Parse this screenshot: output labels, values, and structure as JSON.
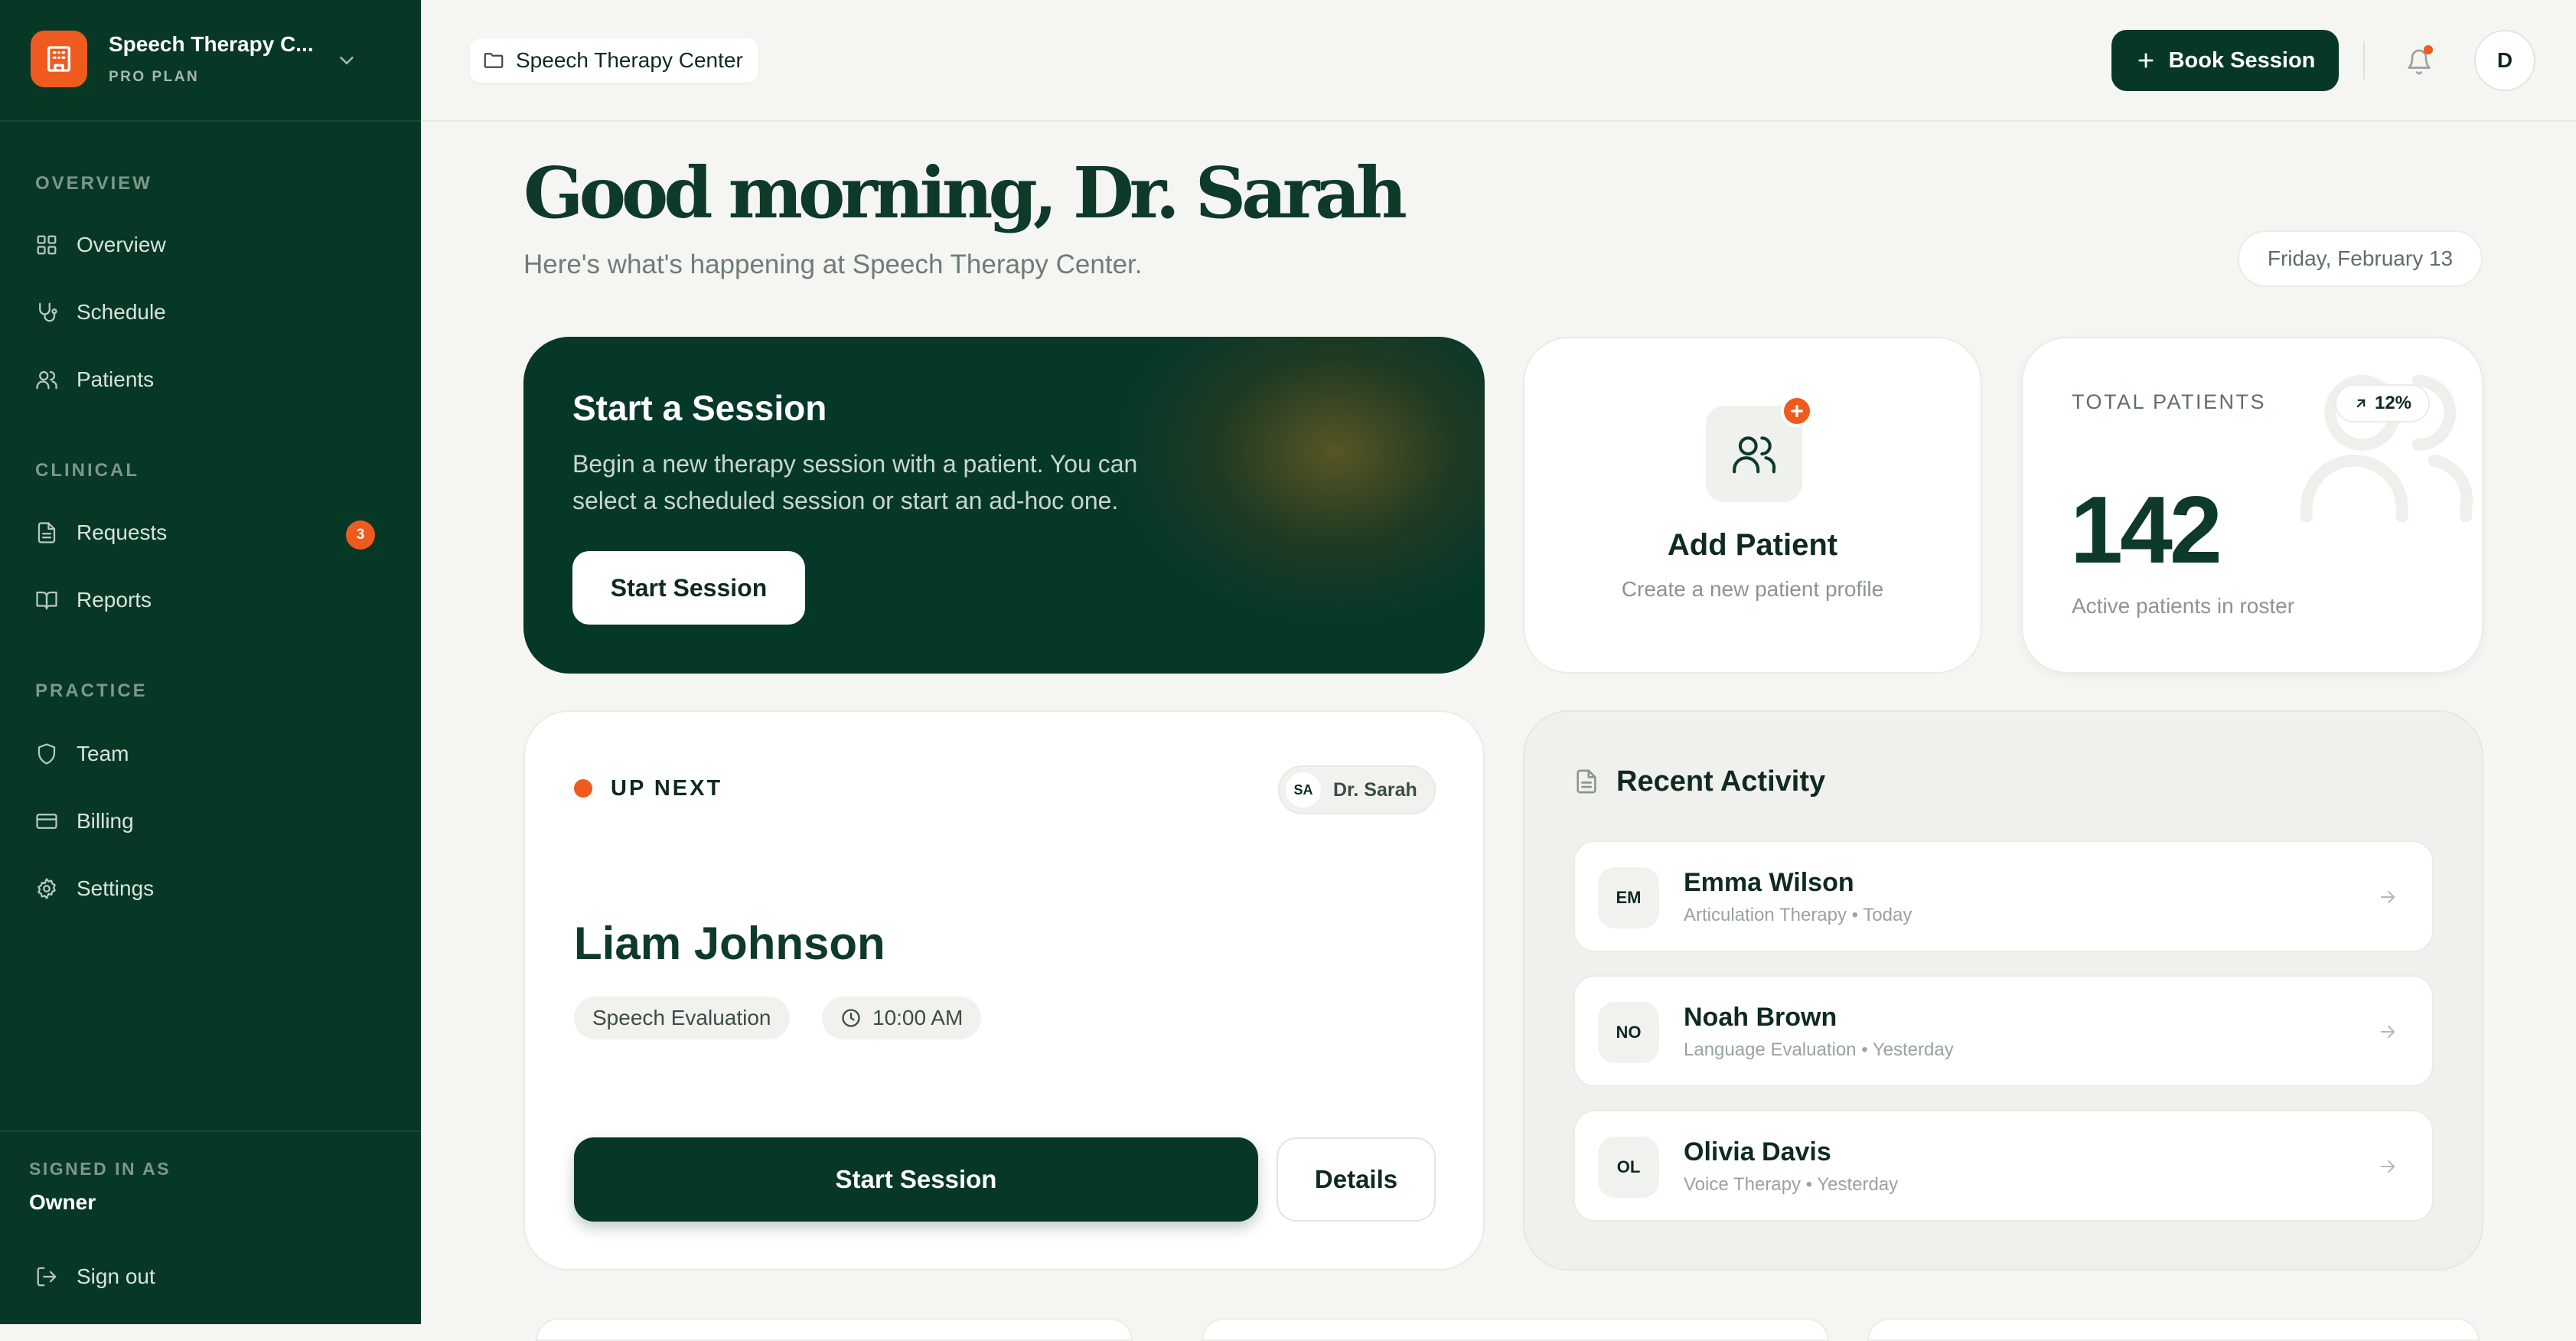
{
  "brand": {
    "name": "Speech Therapy C...",
    "plan": "PRO PLAN"
  },
  "sidebar": {
    "sections": [
      {
        "title": "OVERVIEW",
        "items": [
          {
            "label": "Overview",
            "icon": "grid-icon"
          },
          {
            "label": "Schedule",
            "icon": "stethoscope-icon"
          },
          {
            "label": "Patients",
            "icon": "users-icon"
          }
        ]
      },
      {
        "title": "CLINICAL",
        "items": [
          {
            "label": "Requests",
            "icon": "file-text-icon",
            "badge": "3"
          },
          {
            "label": "Reports",
            "icon": "book-open-icon"
          }
        ]
      },
      {
        "title": "PRACTICE",
        "items": [
          {
            "label": "Team",
            "icon": "shield-icon"
          },
          {
            "label": "Billing",
            "icon": "credit-card-icon"
          },
          {
            "label": "Settings",
            "icon": "gear-icon"
          }
        ]
      }
    ],
    "signed_in_label": "SIGNED IN AS",
    "signed_in_role": "Owner",
    "sign_out_label": "Sign out"
  },
  "header": {
    "breadcrumb": "Speech Therapy Center",
    "book_session_label": "Book Session",
    "avatar_initial": "D"
  },
  "greeting": {
    "title": "Good morning, Dr. Sarah",
    "subtitle": "Here's what's happening at Speech Therapy Center.",
    "date": "Friday, February 13"
  },
  "start_card": {
    "title": "Start a Session",
    "description": "Begin a new therapy session with a patient. You can select a scheduled session or start an ad-hoc one.",
    "button_label": "Start Session"
  },
  "add_patient": {
    "title": "Add Patient",
    "subtitle": "Create a new patient profile"
  },
  "total_patients": {
    "label": "TOTAL PATIENTS",
    "change": "12%",
    "value": "142",
    "subtitle": "Active patients in roster"
  },
  "up_next": {
    "label": "UP NEXT",
    "therapist_initials": "SA",
    "therapist_name": "Dr. Sarah",
    "patient": "Liam Johnson",
    "session_type": "Speech Evaluation",
    "time": "10:00 AM",
    "start_label": "Start Session",
    "details_label": "Details"
  },
  "recent_activity": {
    "title": "Recent Activity",
    "items": [
      {
        "initials": "EM",
        "name": "Emma Wilson",
        "meta": "Articulation Therapy • Today"
      },
      {
        "initials": "NO",
        "name": "Noah Brown",
        "meta": "Language Evaluation • Yesterday"
      },
      {
        "initials": "OL",
        "name": "Olivia Davis",
        "meta": "Voice Therapy • Yesterday"
      }
    ]
  },
  "colors": {
    "sidebar": "#073826",
    "accent": "#ef5a1f",
    "primary": "#073826",
    "background": "#f5f5f1"
  }
}
